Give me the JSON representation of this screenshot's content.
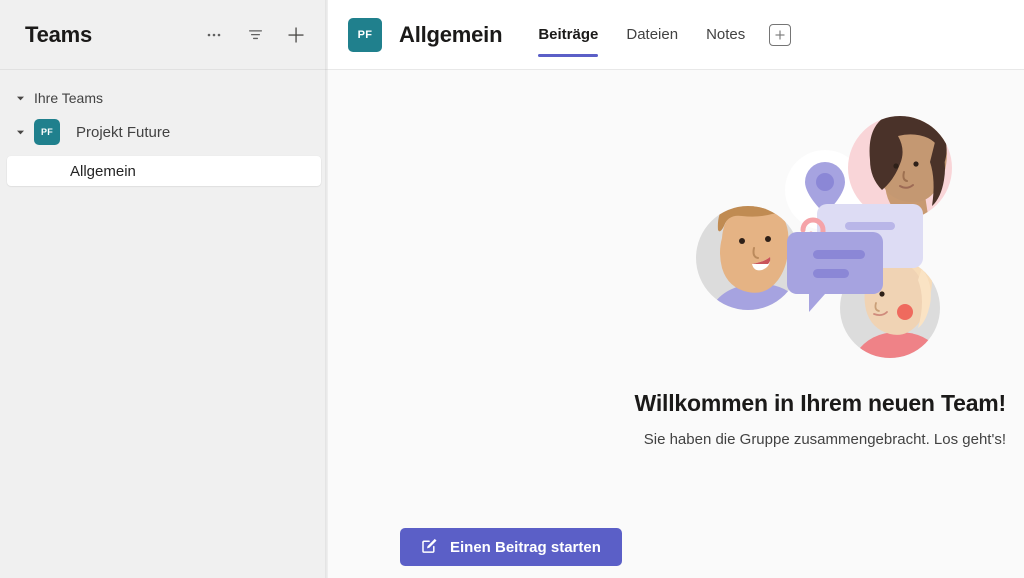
{
  "sidebar": {
    "title": "Teams",
    "actions": [
      {
        "name": "more-options-icon",
        "label": "···"
      },
      {
        "name": "filter-icon",
        "label": "Filter"
      },
      {
        "name": "add-team-icon",
        "label": "+"
      }
    ],
    "tree": {
      "group_label": "Ihre Teams",
      "team": {
        "initials": "PF",
        "name": "Projekt Future",
        "avatar_color": "#20808d"
      },
      "channels": [
        {
          "name": "Allgemein",
          "selected": true
        }
      ]
    }
  },
  "main": {
    "avatar_initials": "PF",
    "title": "Allgemein",
    "tabs": [
      {
        "label": "Beiträge",
        "active": true
      },
      {
        "label": "Dateien",
        "active": false
      },
      {
        "label": "Notes",
        "active": false
      }
    ],
    "add_tab_label": "+",
    "hero": {
      "title": "Willkommen in Ihrem neuen Team!",
      "subtitle": "Sie haben die Gruppe zusammengebracht. Los geht's!"
    },
    "start_post_button": {
      "label": "Einen Beitrag starten",
      "icon": "compose-icon",
      "color": "#5b5fc7"
    }
  },
  "colors": {
    "accent": "#5b5fc7",
    "team_avatar": "#20808d",
    "sidebar_bg": "#f0f0f0",
    "main_bg": "#fafafa"
  }
}
